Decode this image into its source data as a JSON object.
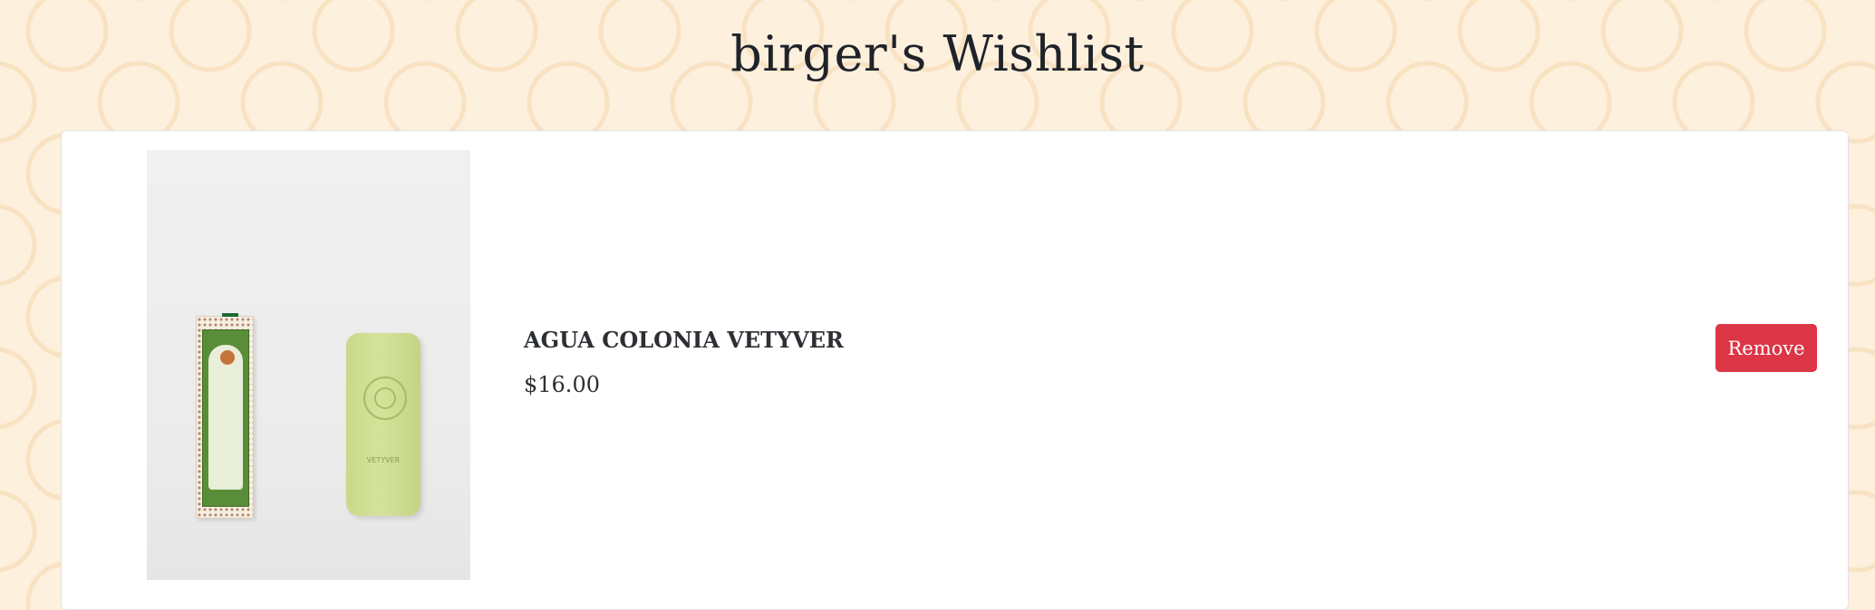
{
  "page": {
    "title": "birger's Wishlist"
  },
  "wishlist": {
    "items": [
      {
        "name": "AGUA COLONIA VETYVER",
        "price": "$16.00",
        "remove_label": "Remove",
        "image_alt": "Agua Colonia Vetyver box and soap bar",
        "soap_stamp_text": "VETYVER"
      }
    ]
  },
  "colors": {
    "background": "#fdf0dd",
    "pattern": "#f8e2c2",
    "remove_button": "#dc3545",
    "text": "#2c2f33"
  }
}
